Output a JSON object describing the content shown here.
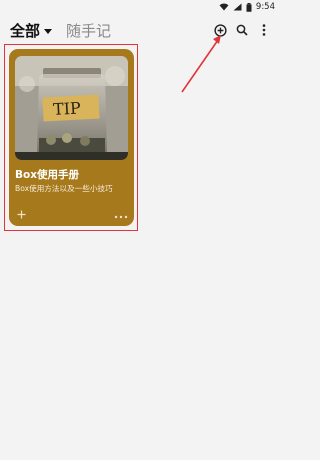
{
  "status_bar": {
    "time": "9:54",
    "icons": [
      "wifi-icon",
      "signal-icon",
      "battery-icon"
    ]
  },
  "header": {
    "tab_all": "全部",
    "tab_notes": "随手记",
    "actions": [
      "add-circle-icon",
      "search-icon",
      "more-vert-icon"
    ]
  },
  "card": {
    "title": "Box使用手册",
    "description": "Box使用方法以及一些小技巧",
    "image_text": "TIP",
    "background_color": "#a6791c",
    "add_icon": "plus-icon",
    "more_icon": "more-horiz-icon"
  },
  "annotation": {
    "highlight_color": "#e0353b"
  }
}
